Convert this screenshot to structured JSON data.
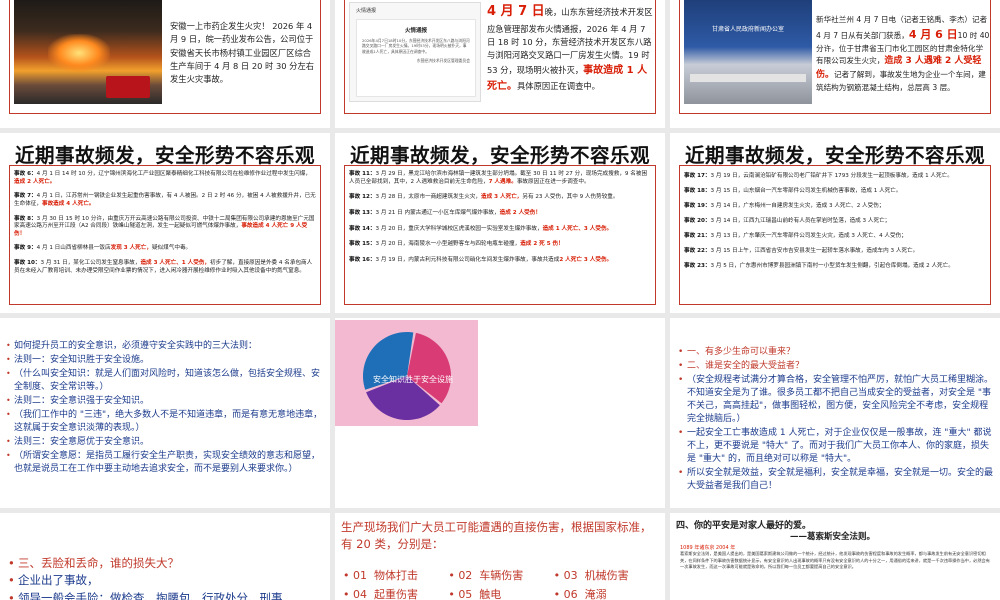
{
  "row1": {
    "s1_text": "安徽一上市药企发生火灾！ 2026 年 4 月 9 日，皖一药业发布公告，公司位于安徽省天长市杨村镇工业园区厂区综合生产车间于 4 月 8 日 20 时 30 分左右发生火灾事故。",
    "s2_doc_title": "火情通报",
    "s2_doc_heading": "火情通报",
    "s2_doc_body": "2026年4月7日18时10分，东营经济技术开发区东八路与浏阳河路交叉路口一厂房发生火情。19时53分，现场明火被扑灭，事故造成1人死亡，具体原因正在调查中。",
    "s2_doc_footer": "东营经济技术开发区管理委员会",
    "s2_date_prefix": "4 月 7 日",
    "s2_text": "晚，山东东营经济技术开发区应急管理部发布火情通报，2026 年 4 月 7 日 18 时 10 分，东营经济技术开发区东八路与浏阳河路交叉路口一厂房发生火情。19 时 53 分，现场明火被扑灭，",
    "s2_red": "事故造成 1 人死亡。",
    "s2_tail": "具体原因正在调查中。",
    "s3_text_a": "新华社兰州 4 月 7 日电（记者王铭禹、李杰）记者 4 月 7 日从有关部门获悉，",
    "s3_red_date": "4 月 6 日",
    "s3_text_b": "10 时 40 分许，位于甘肃省玉门市化工园区的甘肃金特化学有限公司发生火灾，",
    "s3_red": "造成 3 人遇难 2 人受轻伤。",
    "s3_text_c": "记者了解到，事故发生地为企业一个车间，建筑结构为钢筋混凝土结构，总层高 3 层。",
    "s3_banner": "甘肃省人民政府新闻办公室"
  },
  "row2": {
    "title": "近期事故频发，安全形势不容乐观",
    "col1": [
      {
        "label": "事故 6：",
        "text": "4 月 1 日 14 时 10 分，辽宁锦州滨海化工产业园区聚泰精细化工科技有限公司在检维修作业过程中发生闪爆，",
        "red": "造成 2 人死亡。",
        "after": ""
      },
      {
        "label": "事故 7：",
        "text": "4 月 1 日，江苏常州一钢铁企业发生起重伤害事故，有 4 人被困。2 日 2 时 46 分，被困 4 人被救援升井，已无生命体征，",
        "red": "事故造成 4 人死亡。",
        "after": ""
      },
      {
        "label": "事故 8：",
        "text": "3 月 30 日 15 时 10 分许，由重庆万开云高速公路有限公司投资、中铁十二局集团有限公司承建的恩施至广元国家高速公路万州至开江段（A2 合同段）铁峰山隧道左洞，发生一起疑似可燃气体爆炸事故，",
        "red": "事故造成 4 人死亡 9 人受伤！",
        "after": ""
      },
      {
        "label": "事故 9：",
        "text": "4 月 1 日山西省柳林县一饭店",
        "red": "发现 3 人死亡，",
        "after": "疑似煤气中毒。"
      },
      {
        "label": "事故 10：",
        "text": "3 月 31 日，某化工公司发生窒息事故，",
        "red": "造成 3 人死亡、1 人受伤，",
        "after": "初步了解，直接原因是外委 4 名承包商人员在未经入厂教育培训、未办理受限空间作业票的情况下，进入闲冷器开展检维修作业时吸入其他设备中的氮气窒息。"
      }
    ],
    "col2": [
      {
        "label": "事故 11：",
        "text": "3 月 29 日，黑龙江哈尔滨市海林镇一建筑发生部分坍塌。截至 30 日 11 时 27 分，现场完成搜救，9 名被困人员已全部找到，其中，2 人遇难救治目前无生命危险，",
        "red": "7 人遇难。",
        "after": "事故原因正在进一步调查中。"
      },
      {
        "label": "事故 12：",
        "text": "3 月 28 日，太原市一商超建筑发生火灾，",
        "red": "造成 3 人死亡，",
        "after": "另有 23 人受伤，其中 9 人伤势较重。"
      },
      {
        "label": "事故 13：",
        "text": "3 月 21 日 内蒙古通辽一小区车库爆气爆炸事故，",
        "red": "造成 2 人受伤！",
        "after": ""
      },
      {
        "label": "事故 14：",
        "text": "3 月 20 日，重庆大学科学城校区虎溪校园一实验室发生爆炸事故，",
        "red": "造成 1 人死亡、3 人受伤。",
        "after": ""
      },
      {
        "label": "事故 15：",
        "text": "3 月 20 日，海南陵水一小型越野客车与四轮电瓶车碰撞，",
        "red": "造成 2 死 5 伤！",
        "after": ""
      },
      {
        "label": "事故 16：",
        "text": "3 月 19 日，内蒙古利元科技有限公司硝化车间发生爆炸事故，事故共造成",
        "red": "2 人死亡 3 人受伤。",
        "after": ""
      }
    ],
    "col3": [
      {
        "label": "事故 17：",
        "text": "3 月 19 日，云南澜沧铅矿有限公司老厂铅矿井下 1793 分段发生一起顶板事故，造成 1 人死亡。"
      },
      {
        "label": "事故 18：",
        "text": "3 月 15 日，山东烟台一汽车零部件公司发生机械伤害事故，造成 1 人死亡。"
      },
      {
        "label": "事故 19：",
        "text": "3 月 14 日，广东梅州一自建房发生火灾，造成 3 人死亡、2 人受伤；"
      },
      {
        "label": "事故 20：",
        "text": "3 月 14 日，江西九江瑞昌山前岭有人员在掌岩时坠落，造成 3 人死亡；"
      },
      {
        "label": "事故 21：",
        "text": "3 月 13 日，广东肇庆一汽车零部件公司发生火灾，造成 3 人死亡、4 人受伤；"
      },
      {
        "label": "事故 22：",
        "text": "3 月 15 日上午，江西省吉安市吉安县发生一起轿车落水事故，造成车内 3 人死亡。"
      },
      {
        "label": "事故 23：",
        "text": "3 月 5 日，广东惠州市博罗县园洲镇下南村一小型货车发生侧翻，引起仓库倒塌，造成 2 人死亡。"
      }
    ]
  },
  "row3": {
    "s1_lines": [
      "如何提升员工的安全意识，必须遵守安全实践中的三大法则：",
      "法则一：安全知识胜于安全设施。",
      "（什么叫安全知识：就是人们面对风险时，知道该怎么做，包括安全规程、安全制度、安全常识等。）",
      "法则二：安全意识强于安全知识。",
      "（我们工作中的 \"三违\"，绝大多数人不是不知道违章，而是有意无意地违章，这就属于安全意识淡薄的表现。）",
      "法则三：安全意愿优于安全意识。",
      "（所谓安全意愿：是指员工履行安全生产职责，实现安全绩效的意志和愿望，也就是说员工在工作中要主动地去追求安全，而不是要别人来要求你。）"
    ],
    "s2_pie_label": "安全知识胜于安全设施",
    "s2_colors": [
      "#d93b74",
      "#6a2fa0",
      "#1f6fb8"
    ],
    "s3_lines": [
      "一、有多少生命可以重来？",
      "二、谁是安全的最大受益者？",
      "（安全规程考试满分才算合格，安全管理不怕严厉，就怕广大员工稀里糊涂。不知道安全是为了谁。很多员工都不把自己当成安全的受益者，对安全是 \"事不关己，高高挂起\"，做事图轻松，图方便，安全风险完全不考虑，安全规程完全抛脑后。）",
      "一起安全工亡事故造成 1 人死亡，对于企业仅仅是一般事故，连 \"重大\" 都说不上，更不要说是 \"特大\" 了。而对于我们广大员工你本人、你的家庭，损失是 \"重大\" 的，而且绝对可以称是 \"特大\"。",
      "所以安全就是效益，安全就是福利，安全就是幸福，安全就是一切。安全的最大受益者是我们自己！"
    ]
  },
  "row4": {
    "s1_lines": [
      "三、丢脸和丢命，谁的损失大？",
      "企业出了事故，",
      "领导一般会手险：做检查、掏腰包、行政处分、刑事"
    ],
    "s2_title": "生产现场我们广大员工可能遭遇的直接伤害，根据国家标准，有 20 类，分别是：",
    "s2_items": [
      "01  物体打击",
      "02  车辆伤害",
      "03  机械伤害",
      "04  起重伤害",
      "05  触电",
      "06  淹溺"
    ],
    "s3_title": "四、你的平安是对家人最好的爱。",
    "s3_subtitle": "——葛索斯安全法则。",
    "s3_body": "葛索斯安全法则，是美国人提出的，是美国葛索斯建筑公司做的一个统计，经过统计，他发现事故的伤害程度和事故的发生概率，都与事故发生前有无安全意识密切相关，在同样条件下的事故伤害数据统计显示，有安全意识的人出现事故的概率只有没有安全意识的人的十分之一，用通俗的话来讲，就是一千次违章操作当中，必然会有一次事故发生，而这一次事故可能就是致命的，所以我们每一位员工都要提高自己的安全意识。",
    "s3_red": "1089 年诸东京 2004 年"
  }
}
